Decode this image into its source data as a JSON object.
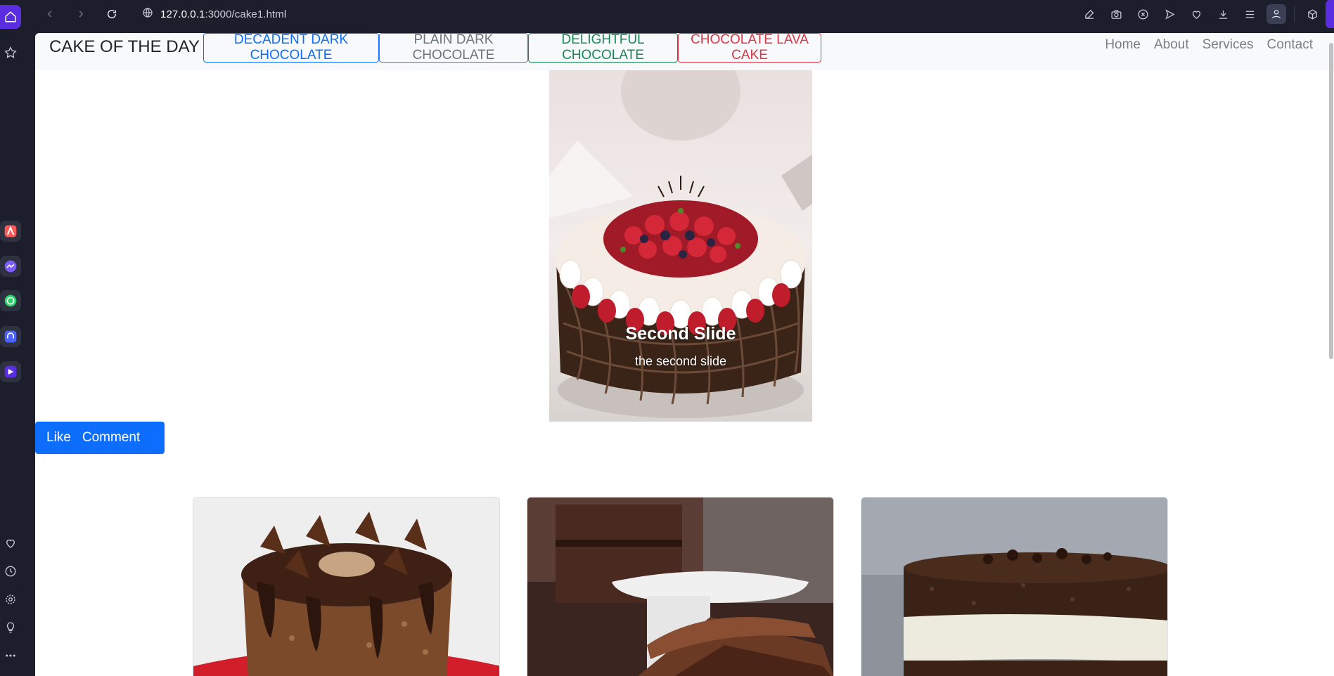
{
  "browser": {
    "url_host": "127.0.0.1",
    "url_path": ":3000/cake1.html"
  },
  "page": {
    "brand": "CAKE OF THE DAY",
    "flavors": [
      {
        "label": "DECADENT DARK CHOCOLATE",
        "color": "#0d6efd"
      },
      {
        "label": "PLAIN DARK CHOCOLATE",
        "color": "#6c757d"
      },
      {
        "label": "DELIGHTFUL CHOCOLATE",
        "color": "#198754"
      },
      {
        "label": "CHOCOLATE LAVA CAKE",
        "color": "#dc3545"
      }
    ],
    "nav_links": [
      "Home",
      "About",
      "Services",
      "Contact"
    ],
    "carousel": {
      "title": "Second Slide",
      "text": "the second slide"
    },
    "actions": {
      "like": "Like",
      "comment": "Comment"
    }
  },
  "colors": {
    "browser_bg": "#1c1f2b",
    "accent": "#5a2ee0",
    "primary": "#0d6efd"
  },
  "icons": [
    "home-icon",
    "bookmark-star-icon",
    "back-icon",
    "forward-icon",
    "reload-icon",
    "globe-icon",
    "edit-icon",
    "camera-icon",
    "shield-icon",
    "send-icon",
    "heart-icon",
    "download-icon",
    "menu-icon",
    "profile-icon",
    "cube-icon",
    "clock-icon",
    "settings-icon",
    "bulb-icon",
    "more-icon"
  ]
}
